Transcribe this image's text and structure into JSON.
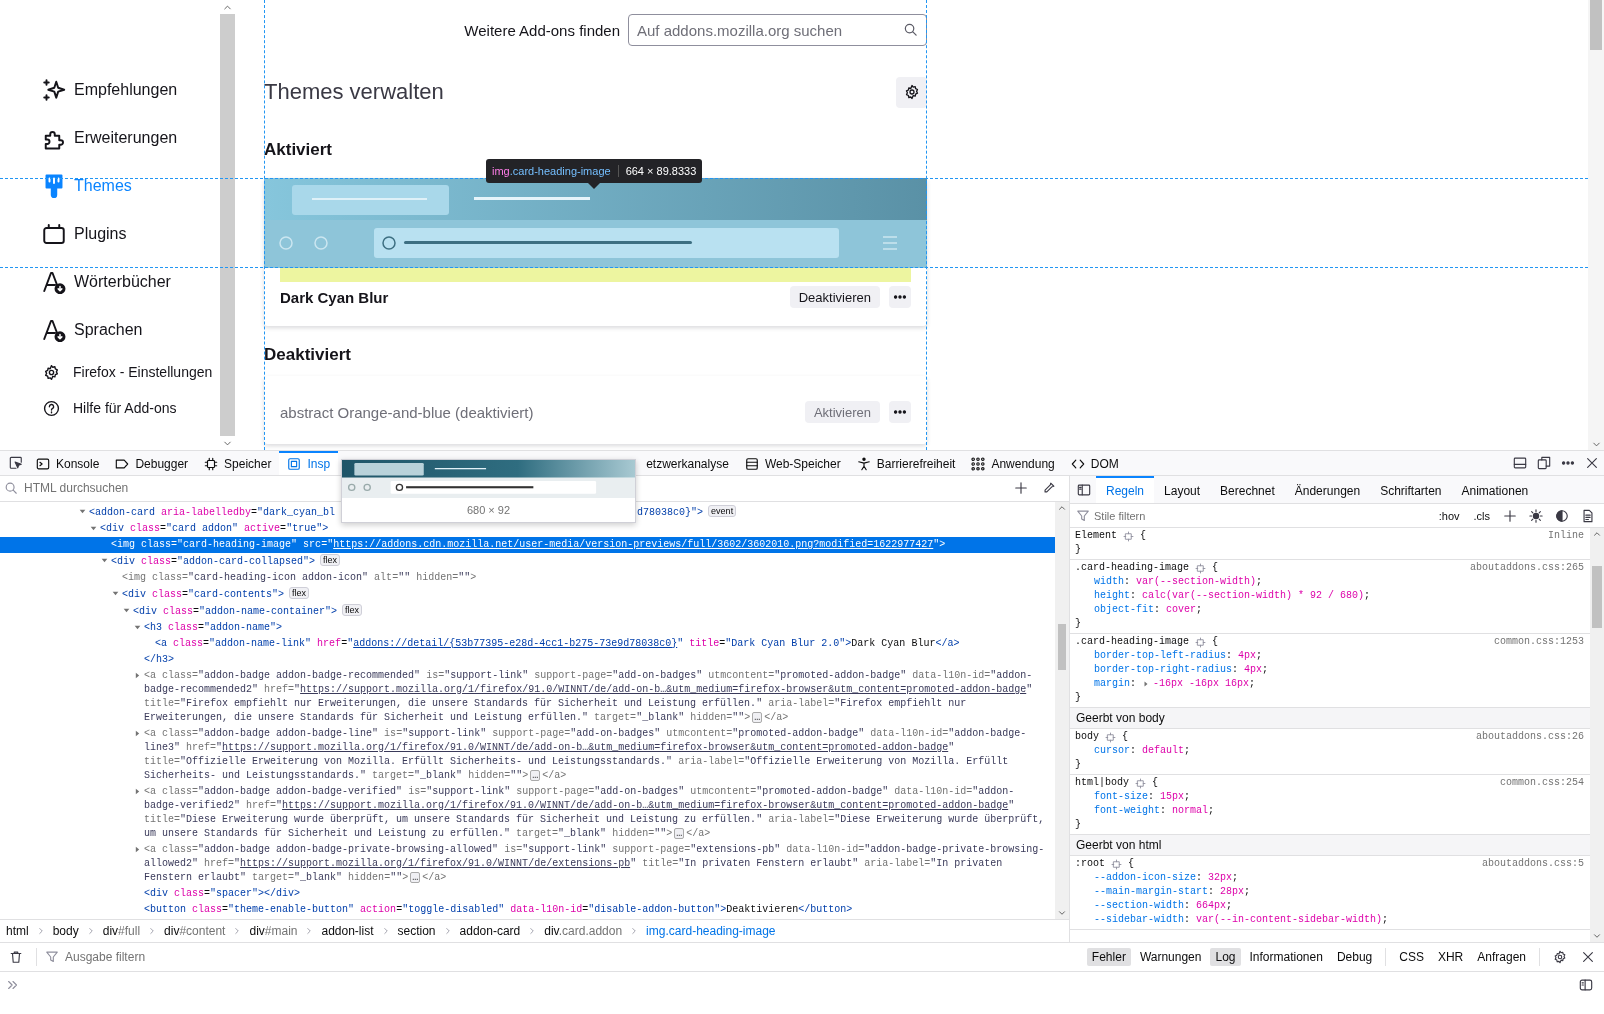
{
  "page": {
    "sidebar": {
      "nav": [
        {
          "label": "Empfehlungen",
          "kind": "sparkle",
          "selected": false
        },
        {
          "label": "Erweiterungen",
          "kind": "puzzle",
          "selected": false
        },
        {
          "label": "Themes",
          "kind": "brush",
          "selected": true
        },
        {
          "label": "Plugins",
          "kind": "plugin",
          "selected": false
        },
        {
          "label": "Wörterbücher",
          "kind": "letter",
          "selected": false
        },
        {
          "label": "Sprachen",
          "kind": "letter",
          "selected": false
        }
      ],
      "links": [
        {
          "label": "Firefox - Einstellungen",
          "kind": "gear"
        },
        {
          "label": "Hilfe für Add-ons",
          "kind": "help"
        }
      ]
    },
    "search": {
      "label": "Weitere Add-ons finden",
      "placeholder": "Auf addons.mozilla.org suchen"
    },
    "heading": "Themes verwalten",
    "sections": [
      {
        "title": "Aktiviert",
        "cards": [
          {
            "name": "Dark Cyan Blur",
            "enabled": true,
            "action": "Deaktivieren",
            "preview": true,
            "highlighted": true
          }
        ]
      },
      {
        "title": "Deaktiviert",
        "cards": [
          {
            "name": "abstract Orange-and-blue (deaktiviert)",
            "enabled": false,
            "action": "Aktivieren",
            "preview": false,
            "highlighted": false
          }
        ]
      }
    ],
    "tooltip": {
      "tag": "img",
      "class_name": ".card-heading-image",
      "size": "664 × 89.8333"
    }
  },
  "devtools": {
    "tabs": [
      {
        "label": "Konsole",
        "kind": "console",
        "selected": false
      },
      {
        "label": "Debugger",
        "kind": "debugger",
        "selected": false
      },
      {
        "label": "Speicher",
        "kind": "memory",
        "selected": false
      },
      {
        "label": "Insp",
        "kind": "inspector",
        "selected": true
      }
    ],
    "tabs_after_preview": [
      {
        "label": "etzwerkanalyse",
        "kind": "plain",
        "selected": false
      },
      {
        "label": "Web-Speicher",
        "kind": "storage",
        "selected": false
      },
      {
        "label": "Barrierefreiheit",
        "kind": "a11y",
        "selected": false
      },
      {
        "label": "Anwendung",
        "kind": "grid",
        "selected": false
      },
      {
        "label": "DOM",
        "kind": "brackets",
        "selected": false
      }
    ],
    "image_preview": {
      "size": "680 × 92"
    },
    "inspector": {
      "search_placeholder": "HTML durchsuchen",
      "tree": [
        {
          "parts": [
            "<addon-card aria-labelledby=\"dark_cyan_bl",
            {
              "kind": "covered"
            },
            "d78038c0}\">",
            {
              "kind": "badge",
              "text": "event"
            }
          ],
          "expanded": true,
          "selected": false,
          "greyed": false,
          "children": [
            {
              "parts": [
                "<div class=\"card addon\" active=\"true\">"
              ],
              "expanded": true,
              "selected": false,
              "greyed": false,
              "children": [
                {
                  "parts": [
                    "<img class=\"card-heading-image\" src=\"",
                    {
                      "kind": "link",
                      "text": "https://addons.cdn.mozilla.net/user-media/version-previews/full/3602/3602010.png?modified=1622977427"
                    },
                    "\">"
                  ],
                  "selected": true,
                  "greyed": false
                },
                {
                  "parts": [
                    "<div class=\"addon-card-collapsed\">",
                    {
                      "kind": "badge",
                      "text": "flex"
                    }
                  ],
                  "expanded": true,
                  "selected": false,
                  "greyed": false,
                  "children": [
                    {
                      "parts": [
                        "<img class=\"card-heading-icon addon-icon\" alt=\"\" hidden=\"\">"
                      ],
                      "selected": false,
                      "greyed": true
                    },
                    {
                      "parts": [
                        "<div class=\"card-contents\">",
                        {
                          "kind": "badge",
                          "text": "flex"
                        }
                      ],
                      "expanded": true,
                      "selected": false,
                      "greyed": false,
                      "children": [
                        {
                          "parts": [
                            "<div class=\"addon-name-container\">",
                            {
                              "kind": "badge",
                              "text": "flex"
                            }
                          ],
                          "expanded": true,
                          "selected": false,
                          "greyed": false,
                          "children": [
                            {
                              "parts": [
                                "<h3 class=\"addon-name\">"
                              ],
                              "expanded": true,
                              "selected": false,
                              "greyed": false,
                              "closing": "</h3>",
                              "children": [
                                {
                                  "parts": [
                                    "<a class=\"addon-name-link\" href=\"",
                                    {
                                      "kind": "link",
                                      "text": "addons://detail/{53b77395-e28d-4cc1-b275-73e9d78038c0}"
                                    },
                                    "\" title=\"Dark Cyan Blur 2.0\">Dark Cyan Blur</a>"
                                  ],
                                  "selected": false,
                                  "greyed": false
                                }
                              ]
                            },
                            {
                              "parts": [
                                "<a class=\"addon-badge addon-badge-recommended\" is=\"support-link\" support-page=\"add-on-badges\" utmcontent=\"promoted-addon-badge\" data-l10n-id=\"addon-badge-recommended2\" href=\"",
                                {
                                  "kind": "link",
                                  "text": "https://support.mozilla.org/1/firefox/91.0/WINNT/de/add-on-b…&utm_medium=firefox-browser&utm_content=promoted-addon-badge"
                                },
                                "\" title=\"Firefox empfiehlt nur Erweiterungen, die unsere Standards für Sicherheit und Leistung erfüllen.\" aria-label=\"Firefox empfiehlt nur Erweiterungen, die unsere Standards für Sicherheit und Leistung erfüllen.\" target=\"_blank\" hidden=\"\">",
                                {
                                  "kind": "ellipsis",
                                  "text": "…"
                                },
                                "</a>"
                              ],
                              "expanded": false,
                              "selected": false,
                              "greyed": true
                            },
                            {
                              "parts": [
                                "<a class=\"addon-badge addon-badge-line\" is=\"support-link\" support-page=\"add-on-badges\" utmcontent=\"promoted-addon-badge\" data-l10n-id=\"addon-badge-line3\" href=\"",
                                {
                                  "kind": "link",
                                  "text": "https://support.mozilla.org/1/firefox/91.0/WINNT/de/add-on-b…&utm_medium=firefox-browser&utm_content=promoted-addon-badge"
                                },
                                "\" title=\"Offizielle Erweiterung von Mozilla. Erfüllt Sicherheits- und Leistungsstandards.\" aria-label=\"Offizielle Erweiterung von Mozilla. Erfüllt Sicherheits- und Leistungsstandards.\" target=\"_blank\" hidden=\"\">",
                                {
                                  "kind": "ellipsis",
                                  "text": "…"
                                },
                                "</a>"
                              ],
                              "expanded": false,
                              "selected": false,
                              "greyed": true
                            },
                            {
                              "parts": [
                                "<a class=\"addon-badge addon-badge-verified\" is=\"support-link\" support-page=\"add-on-badges\" utmcontent=\"promoted-addon-badge\" data-l10n-id=\"addon-badge-verified2\" href=\"",
                                {
                                  "kind": "link",
                                  "text": "https://support.mozilla.org/1/firefox/91.0/WINNT/de/add-on-b…&utm_medium=firefox-browser&utm_content=promoted-addon-badge"
                                },
                                "\" title=\"Diese Erweiterung wurde überprüft, um unsere Standards für Sicherheit und Leistung zu erfüllen.\" aria-label=\"Diese Erweiterung wurde überprüft, um unsere Standards für Sicherheit und Leistung zu erfüllen.\" target=\"_blank\" hidden=\"\">",
                                {
                                  "kind": "ellipsis",
                                  "text": "…"
                                },
                                "</a>"
                              ],
                              "expanded": false,
                              "selected": false,
                              "greyed": true
                            },
                            {
                              "parts": [
                                "<a class=\"addon-badge addon-badge-private-browsing-allowed\" is=\"support-link\" support-page=\"extensions-pb\" data-l10n-id=\"addon-badge-private-browsing-allowed2\" href=\"",
                                {
                                  "kind": "link",
                                  "text": "https://support.mozilla.org/1/firefox/91.0/WINNT/de/extensions-pb"
                                },
                                "\" title=\"In privaten Fenstern erlaubt\" aria-label=\"In privaten Fenstern erlaubt\" target=\"_blank\" hidden=\"\">",
                                {
                                  "kind": "ellipsis",
                                  "text": "…"
                                },
                                "</a>"
                              ],
                              "expanded": false,
                              "selected": false,
                              "greyed": true
                            },
                            {
                              "parts": [
                                "<div class=\"spacer\"></div>"
                              ],
                              "selected": false,
                              "greyed": false
                            },
                            {
                              "parts": [
                                "<button class=\"theme-enable-button\" action=\"toggle-disabled\" data-l10n-id=\"disable-addon-button\">Deaktivieren</button>"
                              ],
                              "selected": false,
                              "greyed": false
                            }
                          ]
                        }
                      ]
                    }
                  ]
                }
              ]
            }
          ]
        }
      ],
      "breadcrumbs": [
        {
          "tag": "html",
          "selected": false
        },
        {
          "tag": "body",
          "selected": false
        },
        {
          "tag": "div",
          "suffix": "#full",
          "selected": false
        },
        {
          "tag": "div",
          "suffix": "#content",
          "selected": false
        },
        {
          "tag": "div",
          "suffix": "#main",
          "selected": false
        },
        {
          "tag": "addon-list",
          "selected": false
        },
        {
          "tag": "section",
          "selected": false
        },
        {
          "tag": "addon-card",
          "selected": false
        },
        {
          "tag": "div",
          "suffix": ".card.addon",
          "selected": false
        },
        {
          "tag": "img",
          "suffix": ".card-heading-image",
          "selected": true
        }
      ]
    },
    "rules_panel": {
      "tabs": [
        {
          "label": "Regeln",
          "selected": true
        },
        {
          "label": "Layout",
          "selected": false
        },
        {
          "label": "Berechnet",
          "selected": false
        },
        {
          "label": "Änderungen",
          "selected": false
        },
        {
          "label": "Schriftarten",
          "selected": false
        },
        {
          "label": "Animationen",
          "selected": false
        }
      ],
      "filter_placeholder": "Stile filtern",
      "toggles": [
        ":hov",
        ".cls"
      ],
      "rules": [
        {
          "kind": "rule",
          "selector": "Element",
          "source": "Inline",
          "open": "{",
          "close": "}"
        },
        {
          "kind": "rule",
          "selector": ".card-heading-image",
          "source": "aboutaddons.css:265",
          "open": "{",
          "close": "}",
          "declarations": [
            {
              "text": "width: var(--section-width);",
              "expandable": false
            },
            {
              "text": "height: calc(var(--section-width) * 92 / 680);",
              "expandable": false
            },
            {
              "text": "object-fit: cover;",
              "expandable": false
            }
          ]
        },
        {
          "kind": "rule",
          "selector": ".card-heading-image",
          "source": "common.css:1253",
          "open": "{",
          "close": "}",
          "declarations": [
            {
              "text": "border-top-left-radius: 4px;",
              "expandable": false
            },
            {
              "text": "border-top-right-radius: 4px;",
              "expandable": false
            },
            {
              "text": "margin: -16px -16px 16px;",
              "expandable": true
            }
          ]
        },
        {
          "kind": "inherited",
          "text": "Geerbt von body"
        },
        {
          "kind": "rule",
          "selector": "body",
          "source": "aboutaddons.css:26",
          "open": "{",
          "close": "}",
          "declarations": [
            {
              "text": "cursor: default;",
              "expandable": false
            }
          ]
        },
        {
          "kind": "rule",
          "selector": "html|body",
          "source": "common.css:254",
          "open": "{",
          "close": "}",
          "declarations": [
            {
              "text": "font-size: 15px;",
              "expandable": false
            },
            {
              "text": "font-weight: normal;",
              "expandable": false
            }
          ]
        },
        {
          "kind": "inherited",
          "text": "Geerbt von html"
        },
        {
          "kind": "rule",
          "selector": ":root",
          "source": "aboutaddons.css:5",
          "open": "{",
          "declarations": [
            {
              "text": "--addon-icon-size: 32px;",
              "expandable": false
            },
            {
              "text": "--main-margin-start: 28px;",
              "expandable": false
            },
            {
              "text": "--section-width: 664px;",
              "expandable": false
            },
            {
              "text": "--sidebar-width: var(--in-content-sidebar-width);",
              "expandable": false
            }
          ]
        }
      ]
    },
    "console": {
      "filter_placeholder": "Ausgabe filtern",
      "levels": [
        {
          "label": "Fehler",
          "selected": true
        },
        {
          "label": "Warnungen",
          "selected": false
        },
        {
          "label": "Log",
          "selected": true
        },
        {
          "label": "Informationen",
          "selected": false
        },
        {
          "label": "Debug",
          "selected": false
        }
      ],
      "requests": [
        {
          "label": "CSS",
          "selected": false
        },
        {
          "label": "XHR",
          "selected": false
        },
        {
          "label": "Anfragen",
          "selected": false
        }
      ]
    }
  }
}
